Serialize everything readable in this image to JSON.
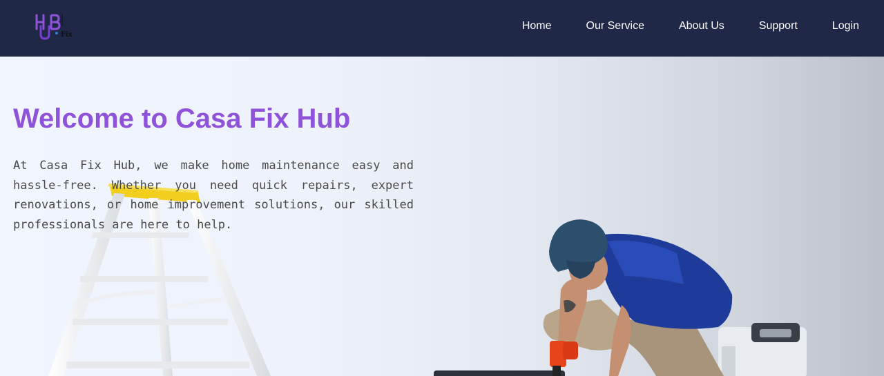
{
  "brand": {
    "logo_text_main": "HUB",
    "logo_text_small": "Fix",
    "logo_accent": "#8f53d9"
  },
  "nav": {
    "items": [
      {
        "label": "Home"
      },
      {
        "label": "Our Service"
      },
      {
        "label": "About Us"
      },
      {
        "label": "Support"
      },
      {
        "label": "Login"
      }
    ]
  },
  "hero": {
    "title": "Welcome to Casa Fix Hub",
    "description": "At Casa Fix Hub, we make home maintenance easy and hassle-free. Whether you need quick repairs, expert renovations, or home improvement solutions, our skilled professionals are here to help."
  },
  "colors": {
    "navbar_bg": "#1f2947",
    "title": "#8f53d9",
    "body_text": "#4a4a4a"
  }
}
